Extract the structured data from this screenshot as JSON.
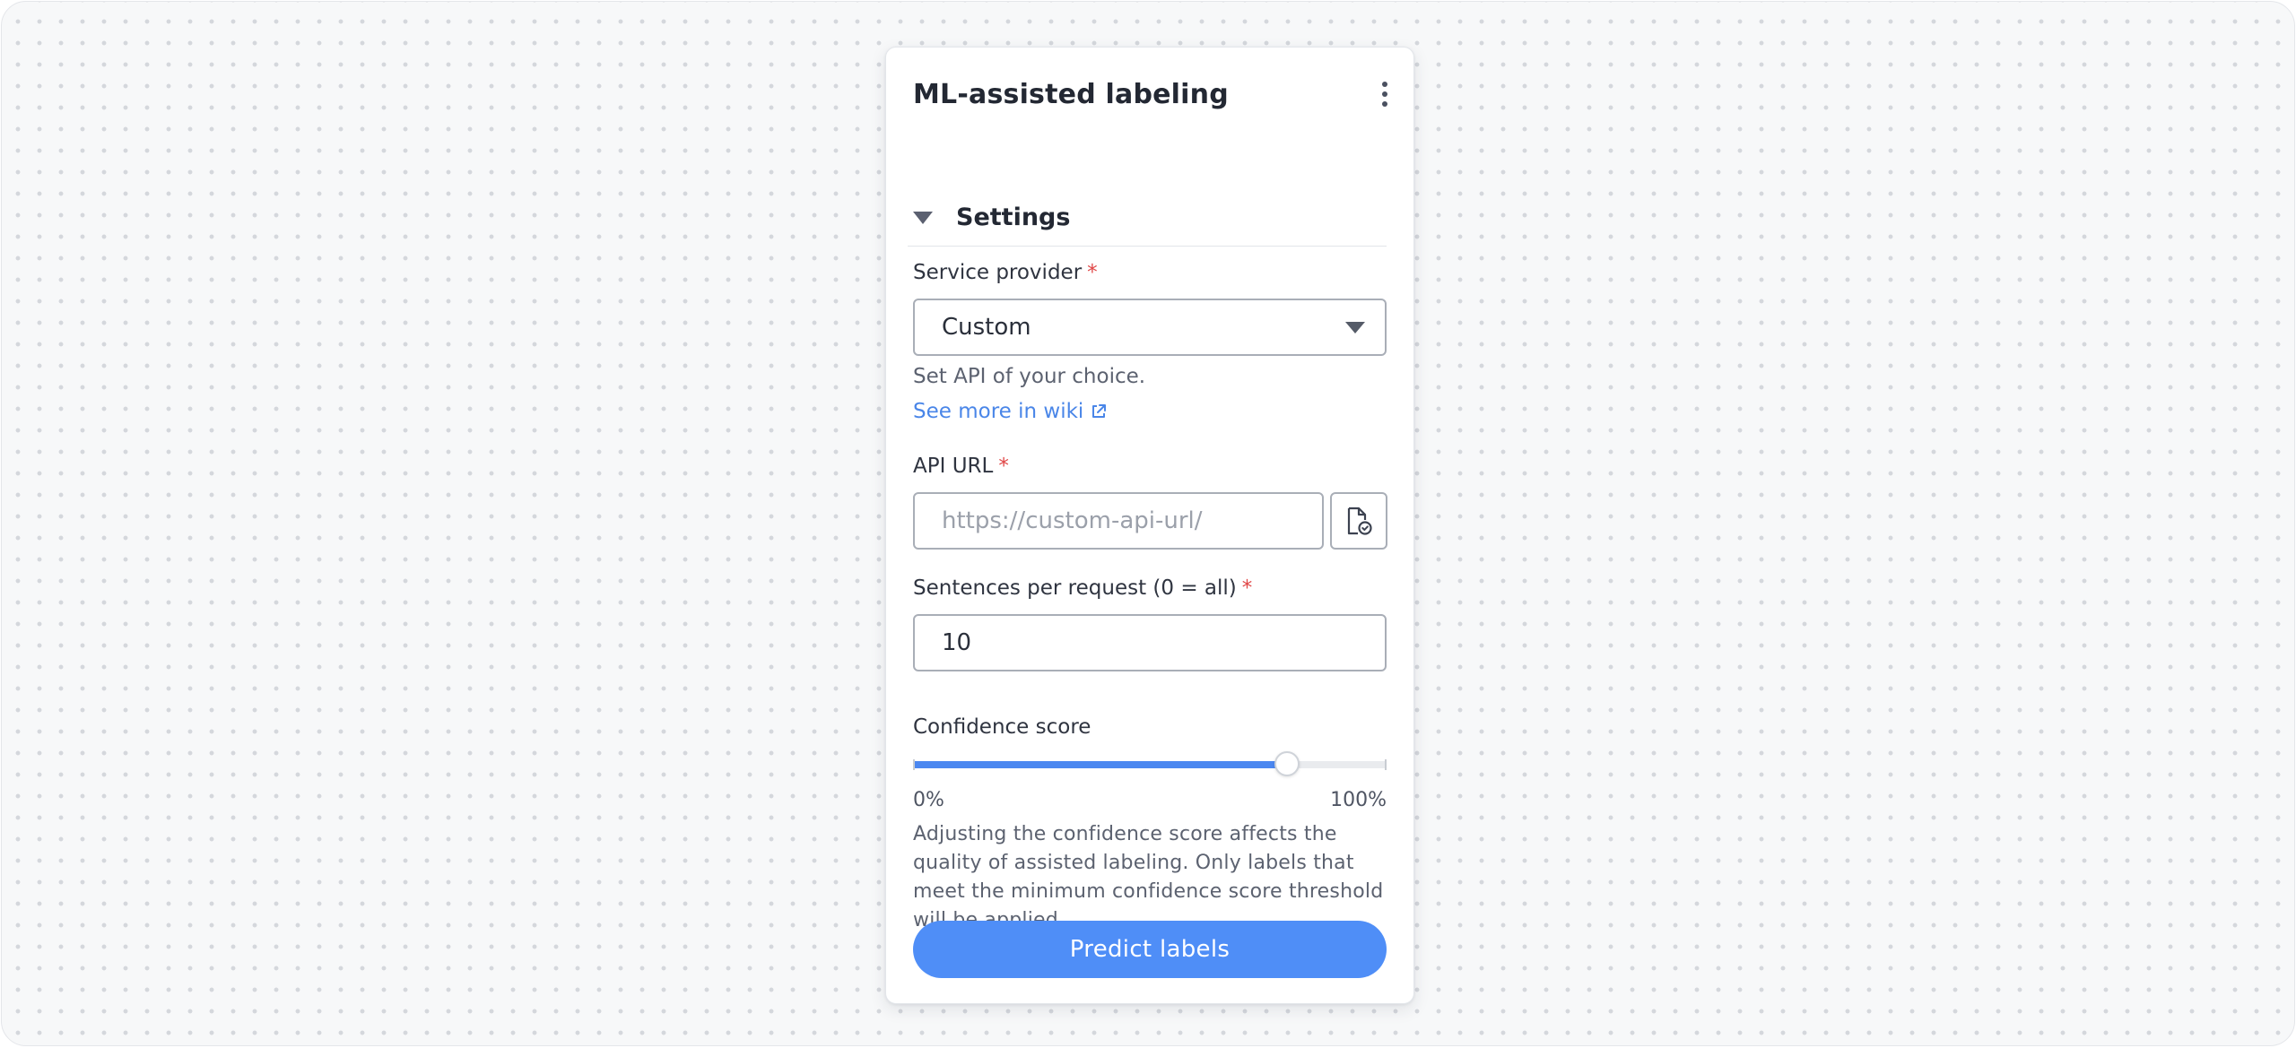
{
  "panel": {
    "title": "ML-assisted labeling"
  },
  "settings": {
    "section_title": "Settings",
    "service_provider": {
      "label": "Service provider",
      "required_mark": "*",
      "selected": "Custom",
      "help": "Set API of your choice.",
      "wiki_link": "See more in wiki"
    },
    "api_url": {
      "label": "API URL",
      "required_mark": "*",
      "placeholder": "https://custom-api-url/",
      "value": ""
    },
    "sentences": {
      "label": "Sentences per request (0 = all)",
      "required_mark": "*",
      "value": "10"
    },
    "confidence": {
      "label": "Confidence score",
      "value_fraction": 0.79,
      "min_label": "0%",
      "max_label": "100%",
      "description": "Adjusting the confidence score affects the quality of assisted labeling. Only labels that meet the minimum confidence score threshold will be applied."
    }
  },
  "actions": {
    "predict_label": "Predict labels"
  },
  "icons": {
    "menu": "more-vertical-icon",
    "collapse": "caret-down-icon",
    "dropdown": "chevron-down-icon",
    "external": "external-link-icon",
    "file": "file-check-icon"
  },
  "colors": {
    "accent": "#4f8ef7",
    "link": "#4a86e8",
    "required": "#e04646",
    "slider_fill": "#4b87f0"
  }
}
